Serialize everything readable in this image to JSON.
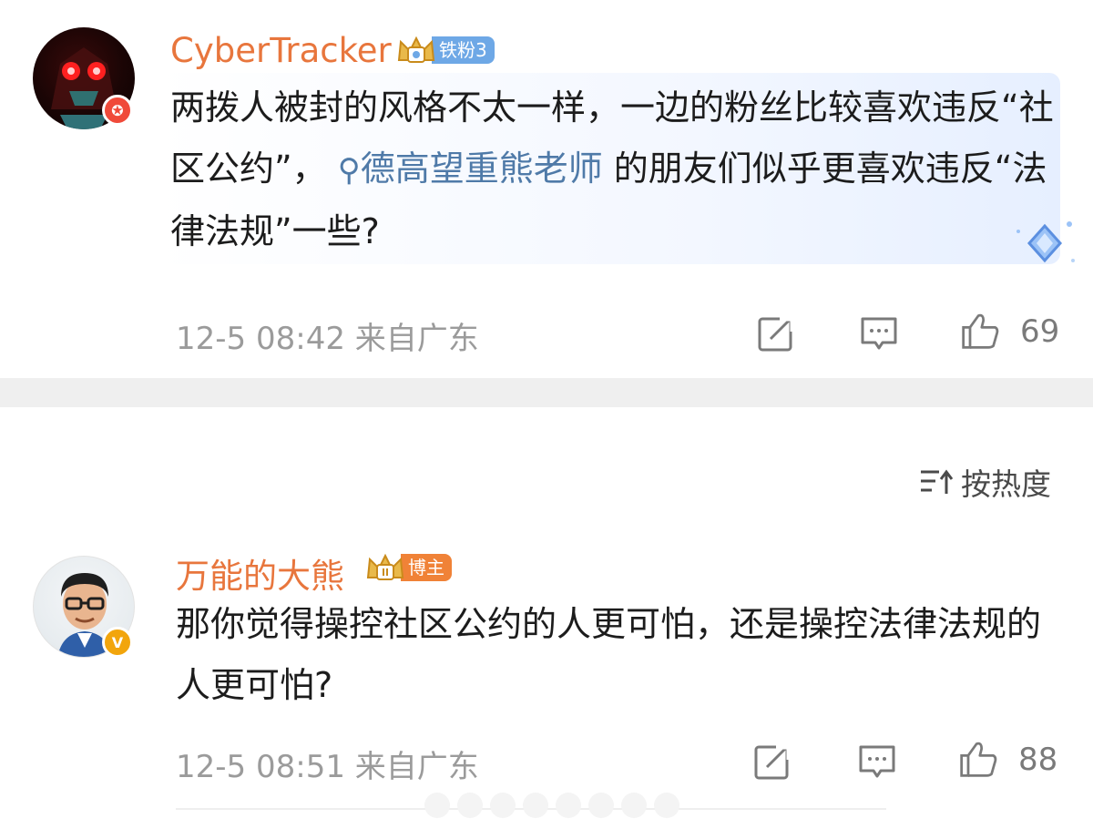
{
  "comments": [
    {
      "username": "CyberTracker",
      "badge_label": "铁粉3",
      "text_before": "两拨人被封的风格不太一样，一边的粉丝比较喜欢违反“社区公约”，",
      "mention": "德高望重熊老师",
      "text_after": " 的朋友们似乎更喜欢违反“法律法规”一些?",
      "timestamp": "12-5 08:42",
      "location": "来自广东",
      "likes": "69"
    },
    {
      "username": "万能的大熊",
      "badge_label": "博主",
      "text": "那你觉得操控社区公约的人更可怕，还是操控法律法规的人更可怕?",
      "timestamp": "12-5 08:51",
      "location": "来自广东",
      "likes": "88"
    }
  ],
  "sort_label": "按热度",
  "icons": {
    "repost": "repost-icon",
    "comment": "comment-icon",
    "like": "like-icon",
    "sort": "sort-icon",
    "search": "search-icon",
    "crown": "crown-icon"
  },
  "colors": {
    "username": "#e8763d",
    "mention": "#4f7aa8",
    "meta": "#9b9b9b",
    "fan_badge": "#6ea8e6",
    "blogger_badge": "#f08237",
    "verify_red": "#f04a3a",
    "verify_gold": "#f2a50c"
  }
}
